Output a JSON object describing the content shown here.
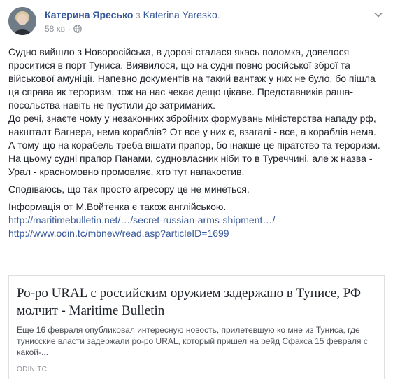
{
  "header": {
    "author_name": "Катерина Яресько",
    "via": " з ",
    "page_name": "Katerina Yaresko",
    "page_suffix": ".",
    "timestamp": "58 хв",
    "separator": "·",
    "privacy_icon": "globe-icon",
    "menu_icon": "chevron-down-icon"
  },
  "post": {
    "paragraphs": [
      "Судно вийшло з Новоросійська, в дорозі сталася якась поломка, довелося проситися в порт Туниса. Виявилося, що на судні повно російської зброї та військової амуніції. Напевно документів на такий вантаж у них не було, бо пішла ця справа як тероризм, тож на нас чекає дещо цікаве. Представників раша-посольства навіть не пустили до затриманих.",
      "До речі, знаєте чому у незаконних збройних формувань міністерства нападу рф, накшталт Вагнера, нема кораблів? От все у них є, взагалі - все, а кораблів нема. А тому що на корабель треба вішати прапор, бо інакше це піратство та тероризм. На цьому судні прапор Панами, судновласник ніби то в Туреччині, але ж назва - Урал - красномовно промовляє, хто тут напакостив.",
      "Сподіваюсь, що так просто агресору це не минеться.",
      "Інформація от М.Войтенка є також англійською."
    ],
    "links": [
      "http://maritimebulletin.net/…/secret-russian-arms-shipment…/",
      "http://www.odin.tc/mbnew/read.asp?articleID=1699"
    ]
  },
  "card": {
    "title": "Ро-ро URAL с российским оружием задержано в Тунисе, РФ молчит - Maritime Bulletin",
    "description": "Еще 16 февраля опубликовал интересную новость, прилетевшую ко мне из Туниса, где тунисские власти задержали ро-ро URAL, который пришел на рейд Сфакса 15 февраля с какой-...",
    "source": "ODIN.TC"
  }
}
